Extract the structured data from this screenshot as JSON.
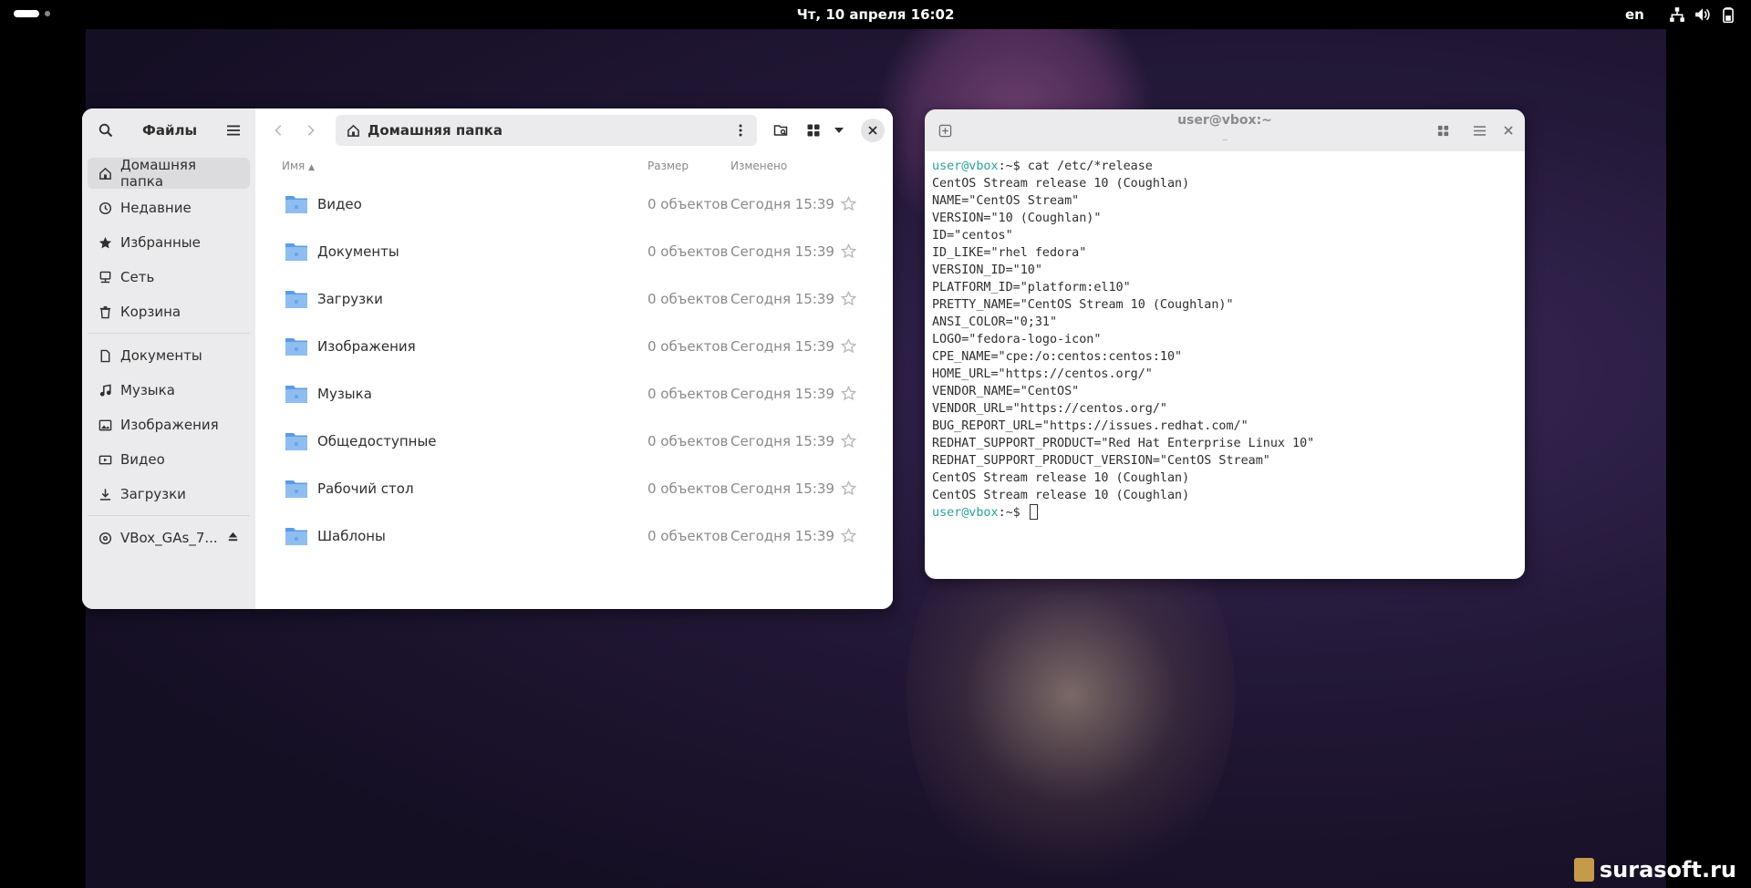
{
  "topbar": {
    "clock": "Чт, 10 апреля  16:02",
    "lang": "en"
  },
  "colors": {
    "accent_folder": "#7fb0e8",
    "prompt": "#2aa198"
  },
  "files": {
    "title": "Файлы",
    "location": "Домашняя папка",
    "sidebar": {
      "places": [
        {
          "label": "Домашняя папка",
          "icon": "home-icon"
        },
        {
          "label": "Недавние",
          "icon": "clock-icon"
        },
        {
          "label": "Избранные",
          "icon": "star-icon"
        },
        {
          "label": "Сеть",
          "icon": "network-icon"
        },
        {
          "label": "Корзина",
          "icon": "trash-icon"
        }
      ],
      "bookmarks": [
        {
          "label": "Документы",
          "icon": "document-icon"
        },
        {
          "label": "Музыка",
          "icon": "music-icon"
        },
        {
          "label": "Изображения",
          "icon": "image-icon"
        },
        {
          "label": "Видео",
          "icon": "video-icon"
        },
        {
          "label": "Загрузки",
          "icon": "download-icon"
        }
      ],
      "devices": [
        {
          "label": "VBox_GAs_7...",
          "icon": "disc-icon"
        }
      ]
    },
    "columns": {
      "name": "Имя",
      "size": "Размер",
      "modified": "Изменено"
    },
    "rows": [
      {
        "name": "Видео",
        "size": "0 объектов",
        "modified": "Сегодня 15:39",
        "icon": "video-folder-icon"
      },
      {
        "name": "Документы",
        "size": "0 объектов",
        "modified": "Сегодня 15:39",
        "icon": "documents-folder-icon"
      },
      {
        "name": "Загрузки",
        "size": "0 объектов",
        "modified": "Сегодня 15:39",
        "icon": "downloads-folder-icon"
      },
      {
        "name": "Изображения",
        "size": "0 объектов",
        "modified": "Сегодня 15:39",
        "icon": "pictures-folder-icon"
      },
      {
        "name": "Музыка",
        "size": "0 объектов",
        "modified": "Сегодня 15:39",
        "icon": "music-folder-icon"
      },
      {
        "name": "Общедоступные",
        "size": "0 объектов",
        "modified": "Сегодня 15:39",
        "icon": "public-folder-icon"
      },
      {
        "name": "Рабочий стол",
        "size": "0 объектов",
        "modified": "Сегодня 15:39",
        "icon": "desktop-folder-icon"
      },
      {
        "name": "Шаблоны",
        "size": "0 объектов",
        "modified": "Сегодня 15:39",
        "icon": "templates-folder-icon"
      }
    ]
  },
  "terminal": {
    "title": "user@vbox:~",
    "subtitle": "_",
    "prompt_user": "user@vbox",
    "prompt_path": ":~$ ",
    "command": "cat /etc/*release",
    "output": [
      "CentOS Stream release 10 (Coughlan)",
      "NAME=\"CentOS Stream\"",
      "VERSION=\"10 (Coughlan)\"",
      "ID=\"centos\"",
      "ID_LIKE=\"rhel fedora\"",
      "VERSION_ID=\"10\"",
      "PLATFORM_ID=\"platform:el10\"",
      "PRETTY_NAME=\"CentOS Stream 10 (Coughlan)\"",
      "ANSI_COLOR=\"0;31\"",
      "LOGO=\"fedora-logo-icon\"",
      "CPE_NAME=\"cpe:/o:centos:centos:10\"",
      "HOME_URL=\"https://centos.org/\"",
      "VENDOR_NAME=\"CentOS\"",
      "VENDOR_URL=\"https://centos.org/\"",
      "BUG_REPORT_URL=\"https://issues.redhat.com/\"",
      "REDHAT_SUPPORT_PRODUCT=\"Red Hat Enterprise Linux 10\"",
      "REDHAT_SUPPORT_PRODUCT_VERSION=\"CentOS Stream\"",
      "CentOS Stream release 10 (Coughlan)",
      "CentOS Stream release 10 (Coughlan)"
    ]
  },
  "watermark": "surasoft.ru"
}
